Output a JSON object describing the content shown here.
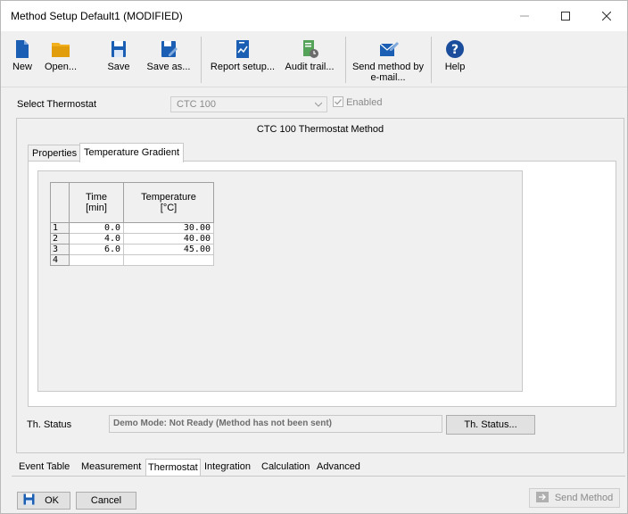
{
  "window": {
    "title": "Method Setup Default1 (MODIFIED)"
  },
  "toolbar": {
    "new": "New",
    "open": "Open...",
    "save": "Save",
    "save_as": "Save as...",
    "report_setup": "Report setup...",
    "audit_trail": "Audit trail...",
    "send_method_email_line1": "Send method by",
    "send_method_email_line2": "e-mail...",
    "help": "Help"
  },
  "thermostat_select": {
    "label": "Select Thermostat",
    "value": "CTC 100",
    "enabled_label": "Enabled"
  },
  "panel": {
    "heading": "CTC 100 Thermostat Method"
  },
  "inner_tabs": [
    "Properties",
    "Temperature Gradient"
  ],
  "grid": {
    "col_time_line1": "Time",
    "col_time_line2": "[min]",
    "col_temp_line1": "Temperature",
    "col_temp_line2": "[°C]",
    "rows": [
      {
        "n": "1",
        "time": "0.0",
        "temp": "30.00"
      },
      {
        "n": "2",
        "time": "4.0",
        "temp": "40.00"
      },
      {
        "n": "3",
        "time": "6.0",
        "temp": "45.00"
      },
      {
        "n": "4",
        "time": "",
        "temp": ""
      }
    ]
  },
  "status": {
    "label": "Th. Status",
    "text": "Demo Mode: Not Ready (Method has not been sent)",
    "button": "Th. Status..."
  },
  "bottom_tabs": [
    "Event Table",
    "Measurement",
    "Thermostat",
    "Integration",
    "Calculation",
    "Advanced"
  ],
  "footer": {
    "ok": "OK",
    "cancel": "Cancel",
    "send_method": "Send Method"
  },
  "colors": {
    "accent": "#1a5fb4",
    "folder": "#f2b01e",
    "help": "#1a4e9c"
  }
}
